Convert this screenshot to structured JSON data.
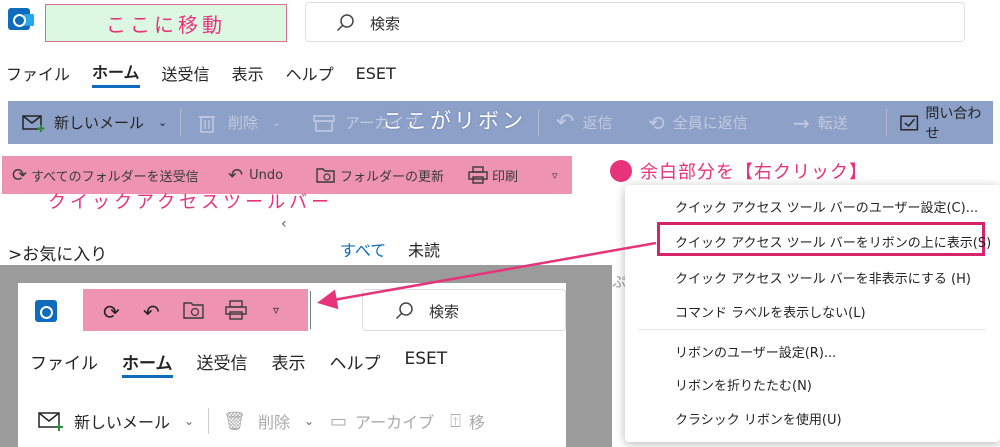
{
  "annotations": {
    "move_here": "ここに移動",
    "ribbon_label": "ここがリボン",
    "qat_label": "クイックアクセスツールバー",
    "hint": "余白部分を【右クリック】"
  },
  "search": {
    "placeholder": "検索"
  },
  "menu_tabs": [
    "ファイル",
    "ホーム",
    "送受信",
    "表示",
    "ヘルプ",
    "ESET"
  ],
  "ribbon": {
    "new_mail": "新しいメール",
    "delete": "削除",
    "archive": "アーカイブ",
    "reply": "返信",
    "reply_all": "全員に返信",
    "forward": "転送",
    "inquiry": "問い合わせ"
  },
  "qat": {
    "send_receive_all": "すべてのフォルダーを送受信",
    "undo": "Undo",
    "update_folder": "フォルダーの更新",
    "print": "印刷"
  },
  "folders": {
    "favorites": "お気に入り",
    "filter_all": "すべて",
    "filter_unread": "未読",
    "cut_text": "ぷ"
  },
  "context_menu": [
    "クイック アクセス ツール バーのユーザー設定(C)...",
    "クイック アクセス ツール バーをリボンの上に表示(S)",
    "クイック アクセス ツール バーを非表示にする (H)",
    "コマンド ラベルを表示しない(L)",
    "リボンのユーザー設定(R)...",
    "リボンを折りたたむ(N)",
    "クラシック リボンを使用(U)"
  ],
  "inset": {
    "search_placeholder": "検索",
    "tabs": [
      "ファイル",
      "ホーム",
      "送受信",
      "表示",
      "ヘルプ",
      "ESET"
    ],
    "new_mail": "新しいメール",
    "delete": "削除",
    "archive": "アーカイブ",
    "move_cut": "移"
  },
  "colors": {
    "accent_pink": "#e6337a",
    "qat_pink": "#ee94b2",
    "ribbon_blue": "#8ca0c8",
    "outlook_blue": "#0f6cbd"
  }
}
